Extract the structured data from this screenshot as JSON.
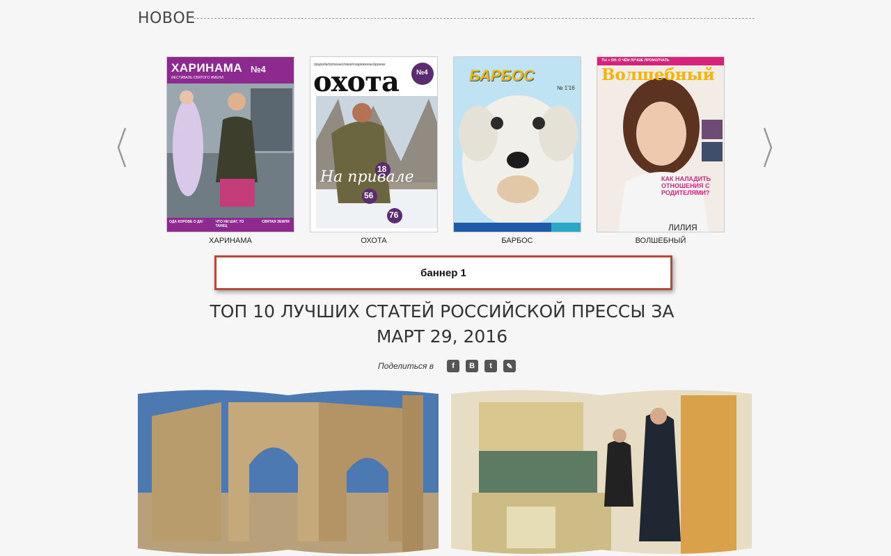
{
  "section": {
    "title": "НОВОЕ"
  },
  "carousel": {
    "items": [
      {
        "name": "ХАРИНАМА",
        "masthead": "ХАРИНАМА",
        "issue": "№4",
        "subtitle": "ФЕСТИВАЛЬ СВЯТОГО ИМЕНИ",
        "footer": [
          "ОДА КОРОВЕ О ДА!",
          "ЧТО НИ ШАГ, ТО ТАНЕЦ",
          "СВЯТАЯ ЗЕМЛЯ"
        ],
        "accent": "#8e2a8f"
      },
      {
        "name": "ОХОТА",
        "masthead": "охота",
        "tagline": "природа/путешествия/снаряжение/оружие",
        "issue": "№4",
        "cover_line": "На привале",
        "numbers": [
          "18",
          "56",
          "76"
        ],
        "accent": "#5b2c6f"
      },
      {
        "name": "БАРБОС",
        "masthead": "БАРБОС",
        "issue": "№ 1'16",
        "accent": "#f2b705"
      },
      {
        "name": "ВОЛШЕБНЫЙ",
        "masthead": "Волшебный",
        "top_line": "ТЫ + ОН: О ЧЁМ ЛУЧШЕ ПРОМОЛЧАТЬ",
        "cover_line": "КАК НАЛАДИТЬ ОТНОШЕНИЯ С РОДИТЕЛЯМИ?",
        "bottom_name": "ЛИЛИЯ ЛАВРОВА",
        "accent": "#d6247a"
      }
    ]
  },
  "banner": {
    "label": "баннер 1"
  },
  "headline": {
    "line1": "ТОП 10 ЛУЧШИХ СТАТЕЙ РОССИЙСКОЙ ПРЕССЫ ЗА",
    "line2": "МАРТ 29, 2016"
  },
  "share": {
    "label": "Поделиться в",
    "buttons": [
      {
        "icon": "facebook-icon",
        "glyph": "f"
      },
      {
        "icon": "vkontakte-icon",
        "glyph": "B"
      },
      {
        "icon": "twitter-icon",
        "glyph": "t"
      },
      {
        "icon": "livejournal-icon",
        "glyph": "✎"
      }
    ]
  },
  "colors": {
    "background": "#f6f6f6",
    "banner_border": "#b54a3a",
    "share_icon": "#555555"
  }
}
